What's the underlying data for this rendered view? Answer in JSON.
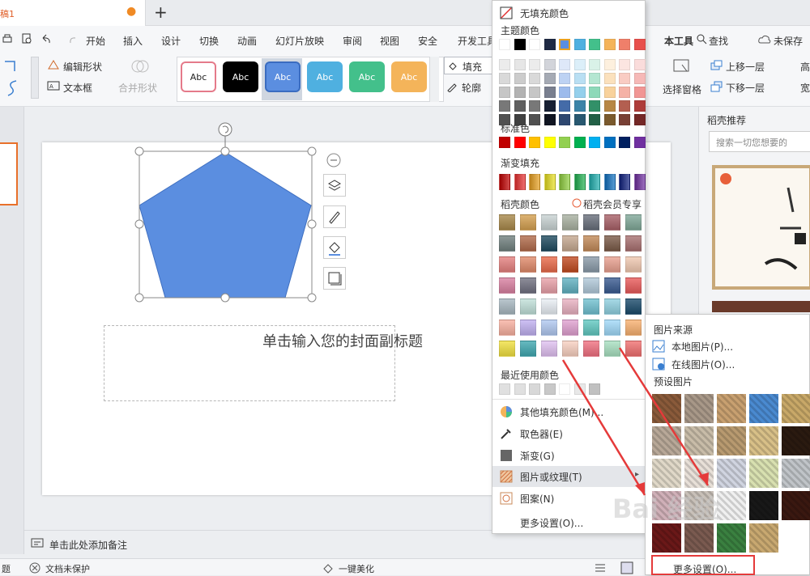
{
  "tabs": {
    "doc_title": "稿1",
    "modified_dot": "●",
    "add": "+"
  },
  "menu": {
    "items": [
      "开始",
      "插入",
      "设计",
      "切换",
      "动画",
      "幻灯片放映",
      "审阅",
      "视图",
      "安全",
      "开发工具"
    ],
    "right": {
      "text_tool": "本工具",
      "search": "查找",
      "unsaved": "未保存"
    }
  },
  "ribbon": {
    "edit_shape": "编辑形状",
    "text_box": "文本框",
    "merge_shape": "合并形状",
    "fill": "填充",
    "outline": "轮廓",
    "select_pane": "选择窗格",
    "bring_forward": "上移一层",
    "send_backward": "下移一层",
    "height": "高",
    "width": "宽",
    "styles": [
      "Abc",
      "Abc",
      "Abc",
      "Abc",
      "Abc",
      "Abc"
    ]
  },
  "slide": {
    "subtitle_placeholder": "单击输入您的封面副标题"
  },
  "notes": {
    "placeholder": "单击此处添加备注"
  },
  "status": {
    "doc_protect": "文档未保护",
    "beautify": "一键美化",
    "left_frag": "题"
  },
  "right_panel": {
    "title": "稻壳推荐",
    "search_placeholder": "搜索一切您想要的"
  },
  "dropdown": {
    "no_fill": "无填充颜色",
    "theme_colors": "主题颜色",
    "standard_colors": "标准色",
    "gradient_fill": "渐变填充",
    "docer_colors": "稻壳颜色",
    "docer_member": "稻壳会员专享",
    "recent_colors": "最近使用颜色",
    "items": [
      "其他填充颜色(M)...",
      "取色器(E)",
      "渐变(G)",
      "图片或纹理(T)",
      "图案(N)",
      "更多设置(O)..."
    ],
    "colors": {
      "theme_top": [
        "#ffffff",
        "#000000",
        "#ffffff",
        "#1f2a44",
        "#5b8ee0",
        "#4fb0e0",
        "#43c08b",
        "#f4b45a",
        "#ef7f6a",
        "#e8504c"
      ],
      "standard": [
        "#c00000",
        "#ff0000",
        "#ffc000",
        "#ffff00",
        "#92d050",
        "#00b050",
        "#00b0f0",
        "#0070c0",
        "#002060",
        "#7030a0"
      ],
      "gradient": [
        "#c00000",
        "#e83030",
        "#e8a020",
        "#e8e020",
        "#90d040",
        "#20b050",
        "#20b0b0",
        "#1070c0",
        "#102080",
        "#7030a0"
      ],
      "docer": [
        [
          "#a8884a",
          "#d4a050",
          "#c8d2d2",
          "#a8b0a0",
          "#686e7a",
          "#a86068",
          "#80a898"
        ],
        [
          "#70807e",
          "#b06a4a",
          "#1e4a5e",
          "#c4a890",
          "#c28a58",
          "#7a5a48",
          "#a87070"
        ],
        [
          "#e4807e",
          "#e08a6a",
          "#e86a4a",
          "#c04a20",
          "#8a9aa8",
          "#e8a090",
          "#f0c8b0"
        ],
        [
          "#d880a0",
          "#707080",
          "#e8a0a8",
          "#60b0c0",
          "#b0c8d8",
          "#3a5a90",
          "#e85a5a"
        ],
        [
          "#a8b8c0",
          "#c0e0d8",
          "#e8eef4",
          "#e8b0c0",
          "#70c0d0",
          "#90d0e0",
          "#1a4a6a"
        ],
        [
          "#f8b0a0",
          "#c0b0f0",
          "#b0c8f0",
          "#e0a0d0",
          "#60c8c0",
          "#a0d8f8",
          "#f8b070"
        ],
        [
          "#f0e040",
          "#40a8b0",
          "#e0c0f0",
          "#f8d0c0",
          "#f07080",
          "#a8e0c0",
          "#f07070"
        ]
      ],
      "recent": [
        "#e0e0e0",
        "#e0e0e0",
        "#d8d8d8",
        "#c8c8c8",
        "#ffffff",
        "#e8e8e8",
        "#c0c0c0"
      ]
    }
  },
  "submenu": {
    "source_title": "图片来源",
    "local": "本地图片(P)...",
    "online": "在线图片(O)...",
    "preset_title": "预设图片",
    "more": "更多设置(O)...",
    "textures": [
      [
        "#8a5a3a",
        "#a89888",
        "#c8a070",
        "#4a8ad0",
        "#c8a868"
      ],
      [
        "#b8a898",
        "#c8bca8",
        "#b89a70",
        "#d8c088",
        "#2a1a10"
      ],
      [
        "#e0d8c8",
        "#e8e0d8",
        "#d0d4e0",
        "#d8e0b0",
        "#c0c4c8"
      ],
      [
        "#d0b0b8",
        "#c8c0b8",
        "#f0f0f0",
        "#181818",
        "#3a1810"
      ],
      [
        "#6a1818",
        "#7a5a50",
        "#3a8040",
        "#c8a870"
      ]
    ]
  },
  "watermark": "Bai 经验"
}
